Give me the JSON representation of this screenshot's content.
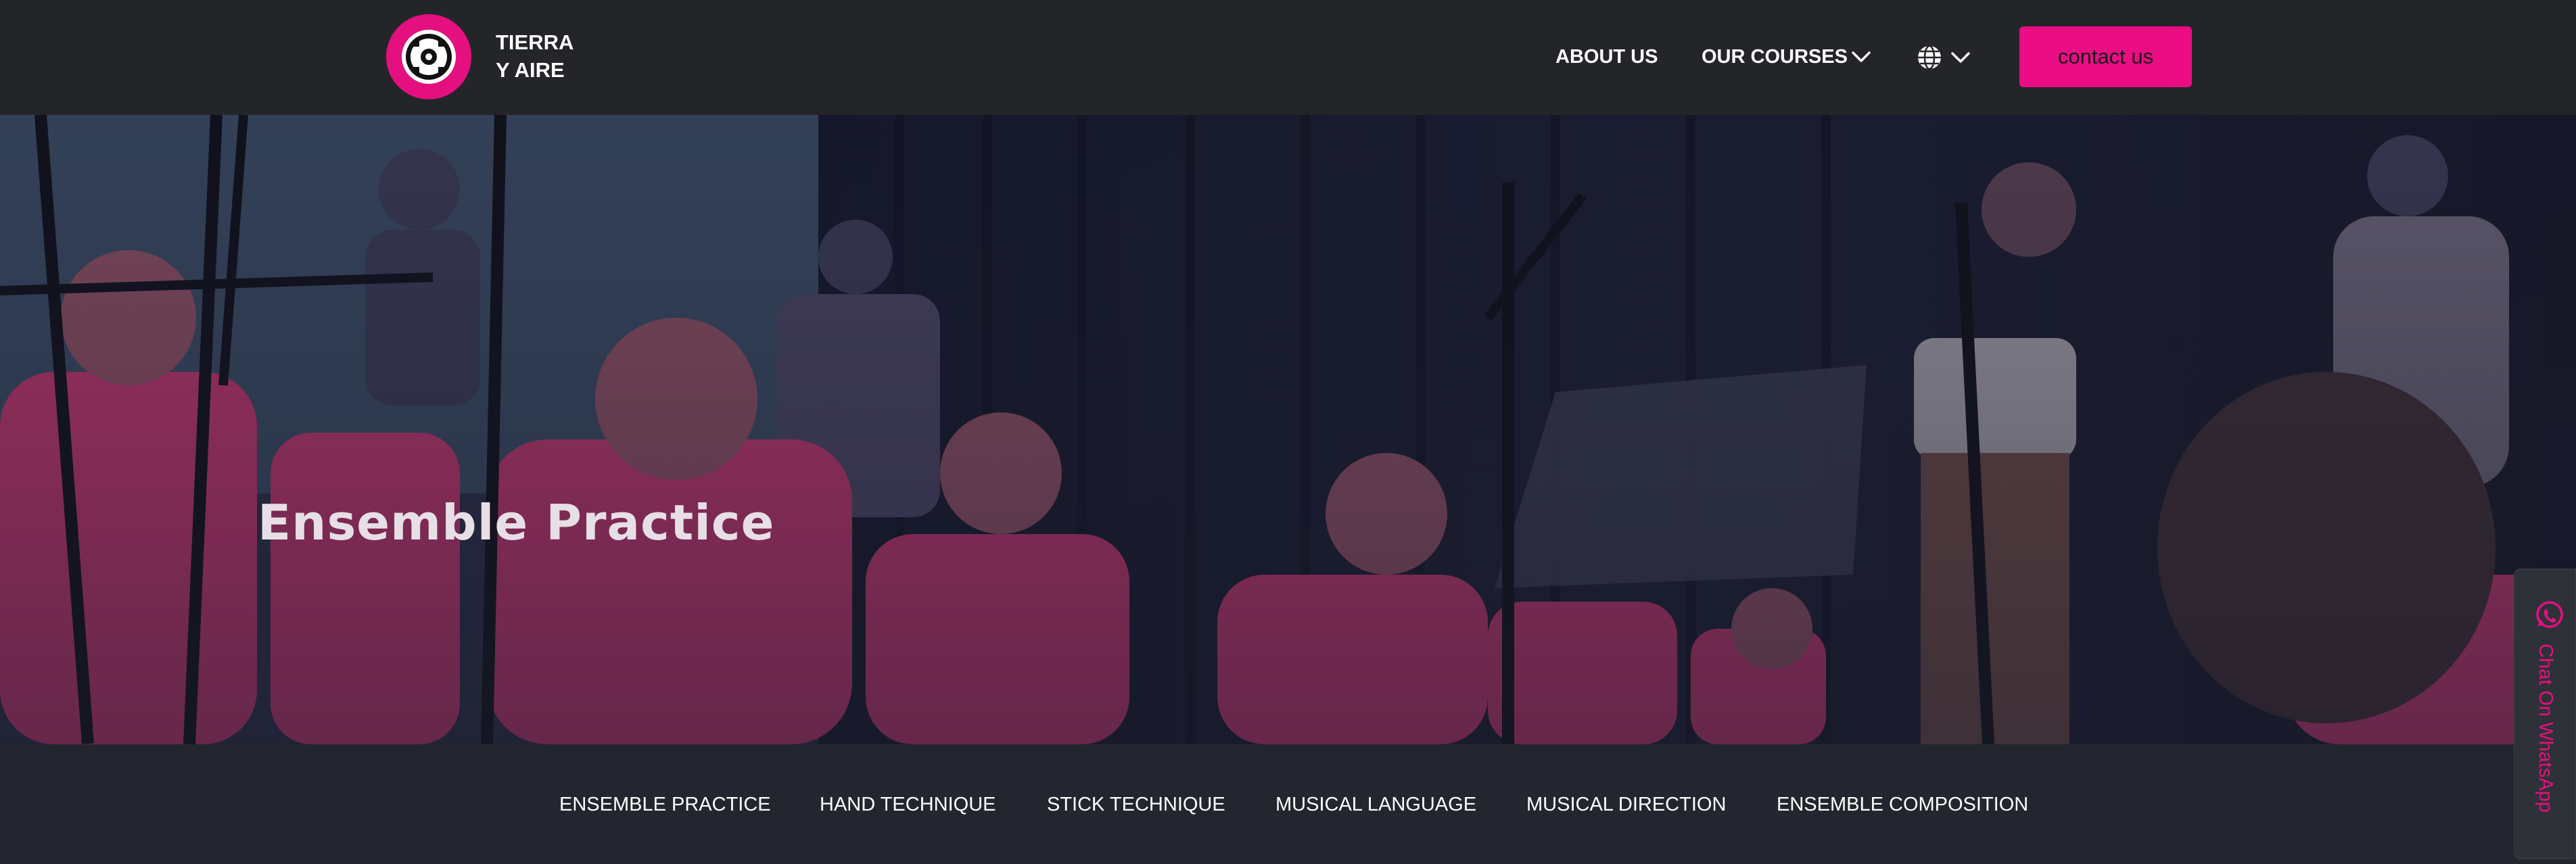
{
  "header": {
    "brand_line1": "TIERRA",
    "brand_line2": "Y AIRE",
    "logo_icon": "tierra-y-aire-logo",
    "nav": {
      "about": "ABOUT US",
      "courses": "OUR COURSES",
      "language_icon": "globe-icon"
    },
    "contact_label": "contact us"
  },
  "hero": {
    "title": "Ensemble Practice"
  },
  "subnav": {
    "items": [
      "ENSEMBLE PRACTICE",
      "HAND TECHNIQUE",
      "STICK TECHNIQUE",
      "MUSICAL LANGUAGE",
      "MUSICAL DIRECTION",
      "ENSEMBLE COMPOSITION"
    ]
  },
  "whatsapp": {
    "label": "Chat On WhatsApp",
    "icon": "whatsapp-icon"
  },
  "colors": {
    "accent": "#ea0d84",
    "header_bg": "#232529",
    "subnav_bg": "#23262e"
  }
}
